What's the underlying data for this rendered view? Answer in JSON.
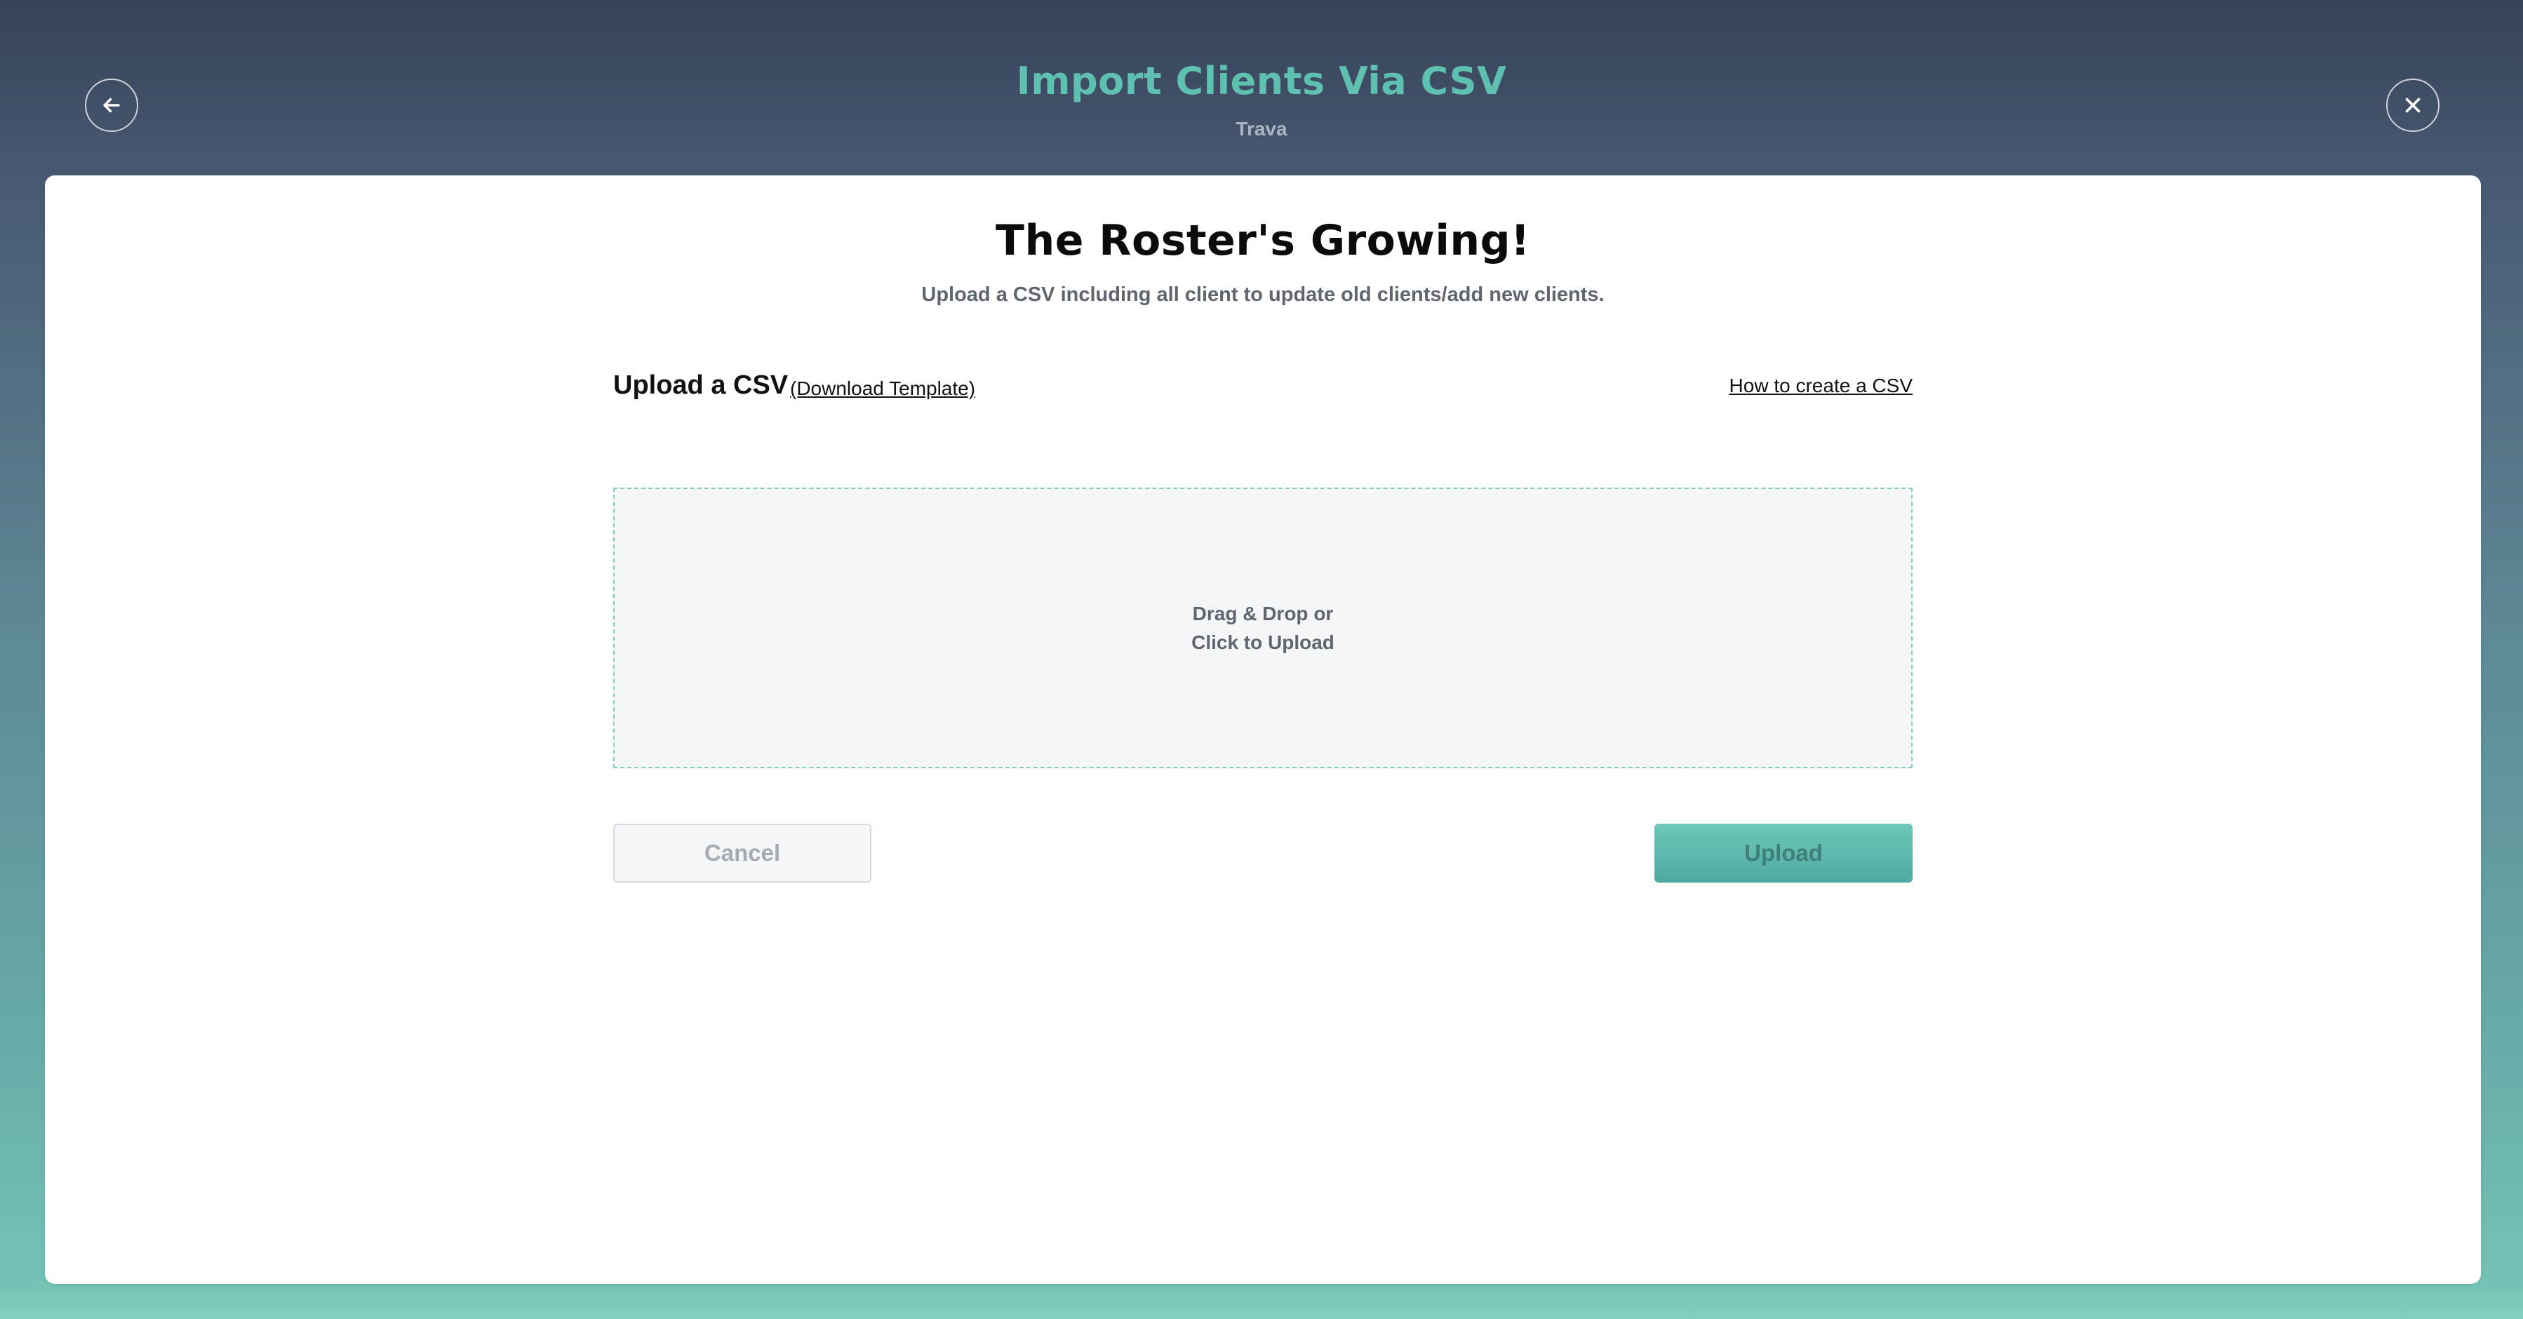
{
  "header": {
    "title": "Import Clients Via CSV",
    "subtitle": "Trava",
    "back_icon": "arrow-left-icon",
    "close_icon": "close-icon"
  },
  "card": {
    "heading": "The Roster's Growing!",
    "description": "Upload a CSV including all client to update old clients/add new clients.",
    "upload_label": "Upload a CSV",
    "download_template_link": "(Download Template)",
    "how_to_link": "How to create a CSV",
    "dropzone": {
      "line1": "Drag & Drop or",
      "line2": "Click to Upload"
    },
    "cancel_label": "Cancel",
    "upload_button_label": "Upload"
  },
  "colors": {
    "accent": "#5ec1b0",
    "dropzone_border": "#7fcfbf",
    "upload_button": "#4fa9a3"
  }
}
